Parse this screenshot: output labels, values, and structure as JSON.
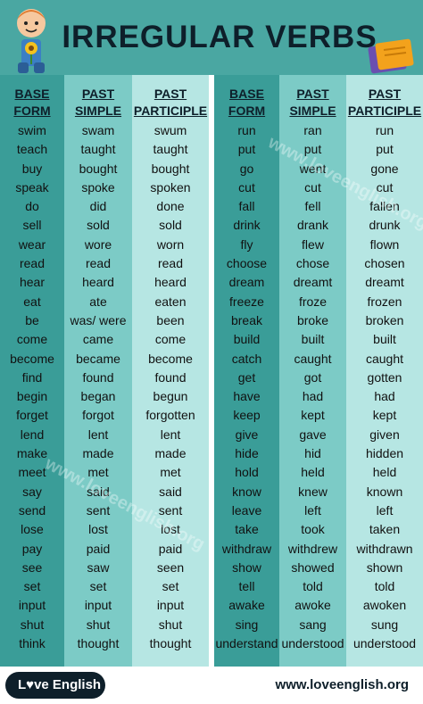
{
  "header": {
    "title": "IRREGULAR VERBS"
  },
  "left_table": {
    "headers": {
      "base": "BASE\nFORM",
      "past": "PAST\nSIMPLE",
      "participle": "PAST\nPARTICIPLE"
    },
    "base": [
      "swim",
      "teach",
      "buy",
      "speak",
      "do",
      "sell",
      "wear",
      "read",
      "hear",
      "eat",
      "be",
      "come",
      "become",
      "find",
      "begin",
      "forget",
      "lend",
      "make",
      "meet",
      "say",
      "send",
      "lose",
      "pay",
      "see",
      "set",
      "input",
      "shut",
      "think"
    ],
    "past": [
      "swam",
      "taught",
      "bought",
      "spoke",
      "did",
      "sold",
      "wore",
      "read",
      "heard",
      "ate",
      "was/ were",
      "came",
      "became",
      "found",
      "began",
      "forgot",
      "lent",
      "made",
      "met",
      "said",
      "sent",
      "lost",
      "paid",
      "saw",
      "set",
      "input",
      "shut",
      "thought"
    ],
    "participle": [
      "swum",
      "taught",
      "bought",
      "spoken",
      "done",
      "sold",
      "worn",
      "read",
      "heard",
      "eaten",
      "been",
      "come",
      "become",
      "found",
      "begun",
      "forgotten",
      "lent",
      "made",
      "met",
      "said",
      "sent",
      "lost",
      "paid",
      "seen",
      "set",
      "input",
      "shut",
      "thought"
    ]
  },
  "right_table": {
    "headers": {
      "base": "BASE\nFORM",
      "past": "PAST\nSIMPLE",
      "participle": "PAST\nPARTICIPLE"
    },
    "base": [
      "run",
      "put",
      "go",
      "cut",
      "fall",
      "drink",
      "fly",
      "choose",
      "dream",
      "freeze",
      "break",
      "build",
      "catch",
      "get",
      "have",
      "keep",
      "give",
      "hide",
      "hold",
      "know",
      "leave",
      "take",
      "withdraw",
      "show",
      "tell",
      "awake",
      "sing",
      "understand"
    ],
    "past": [
      "ran",
      "put",
      "went",
      "cut",
      "fell",
      "drank",
      "flew",
      "chose",
      "dreamt",
      "froze",
      "broke",
      "built",
      "caught",
      "got",
      "had",
      "kept",
      "gave",
      "hid",
      "held",
      "knew",
      "left",
      "took",
      "withdrew",
      "showed",
      "told",
      "awoke",
      "sang",
      "understood"
    ],
    "participle": [
      "run",
      "put",
      "gone",
      "cut",
      "fallen",
      "drunk",
      "flown",
      "chosen",
      "dreamt",
      "frozen",
      "broken",
      "built",
      "caught",
      "gotten",
      "had",
      "kept",
      "given",
      "hidden",
      "held",
      "known",
      "left",
      "taken",
      "withdrawn",
      "shown",
      "told",
      "awoken",
      "sung",
      "understood"
    ]
  },
  "watermark": "www.loveenglish.org",
  "footer": {
    "logo": "L♥ve English",
    "site": "www.loveenglish.org"
  },
  "colors": {
    "teal_dark": "#3a9d98",
    "teal_mid": "#7ccbc6",
    "teal_light": "#b6e6e3",
    "header_bg": "#4aa7a2",
    "navy": "#0e1f2a"
  },
  "icons": [
    "kid-with-flower-icon",
    "books-icon"
  ]
}
